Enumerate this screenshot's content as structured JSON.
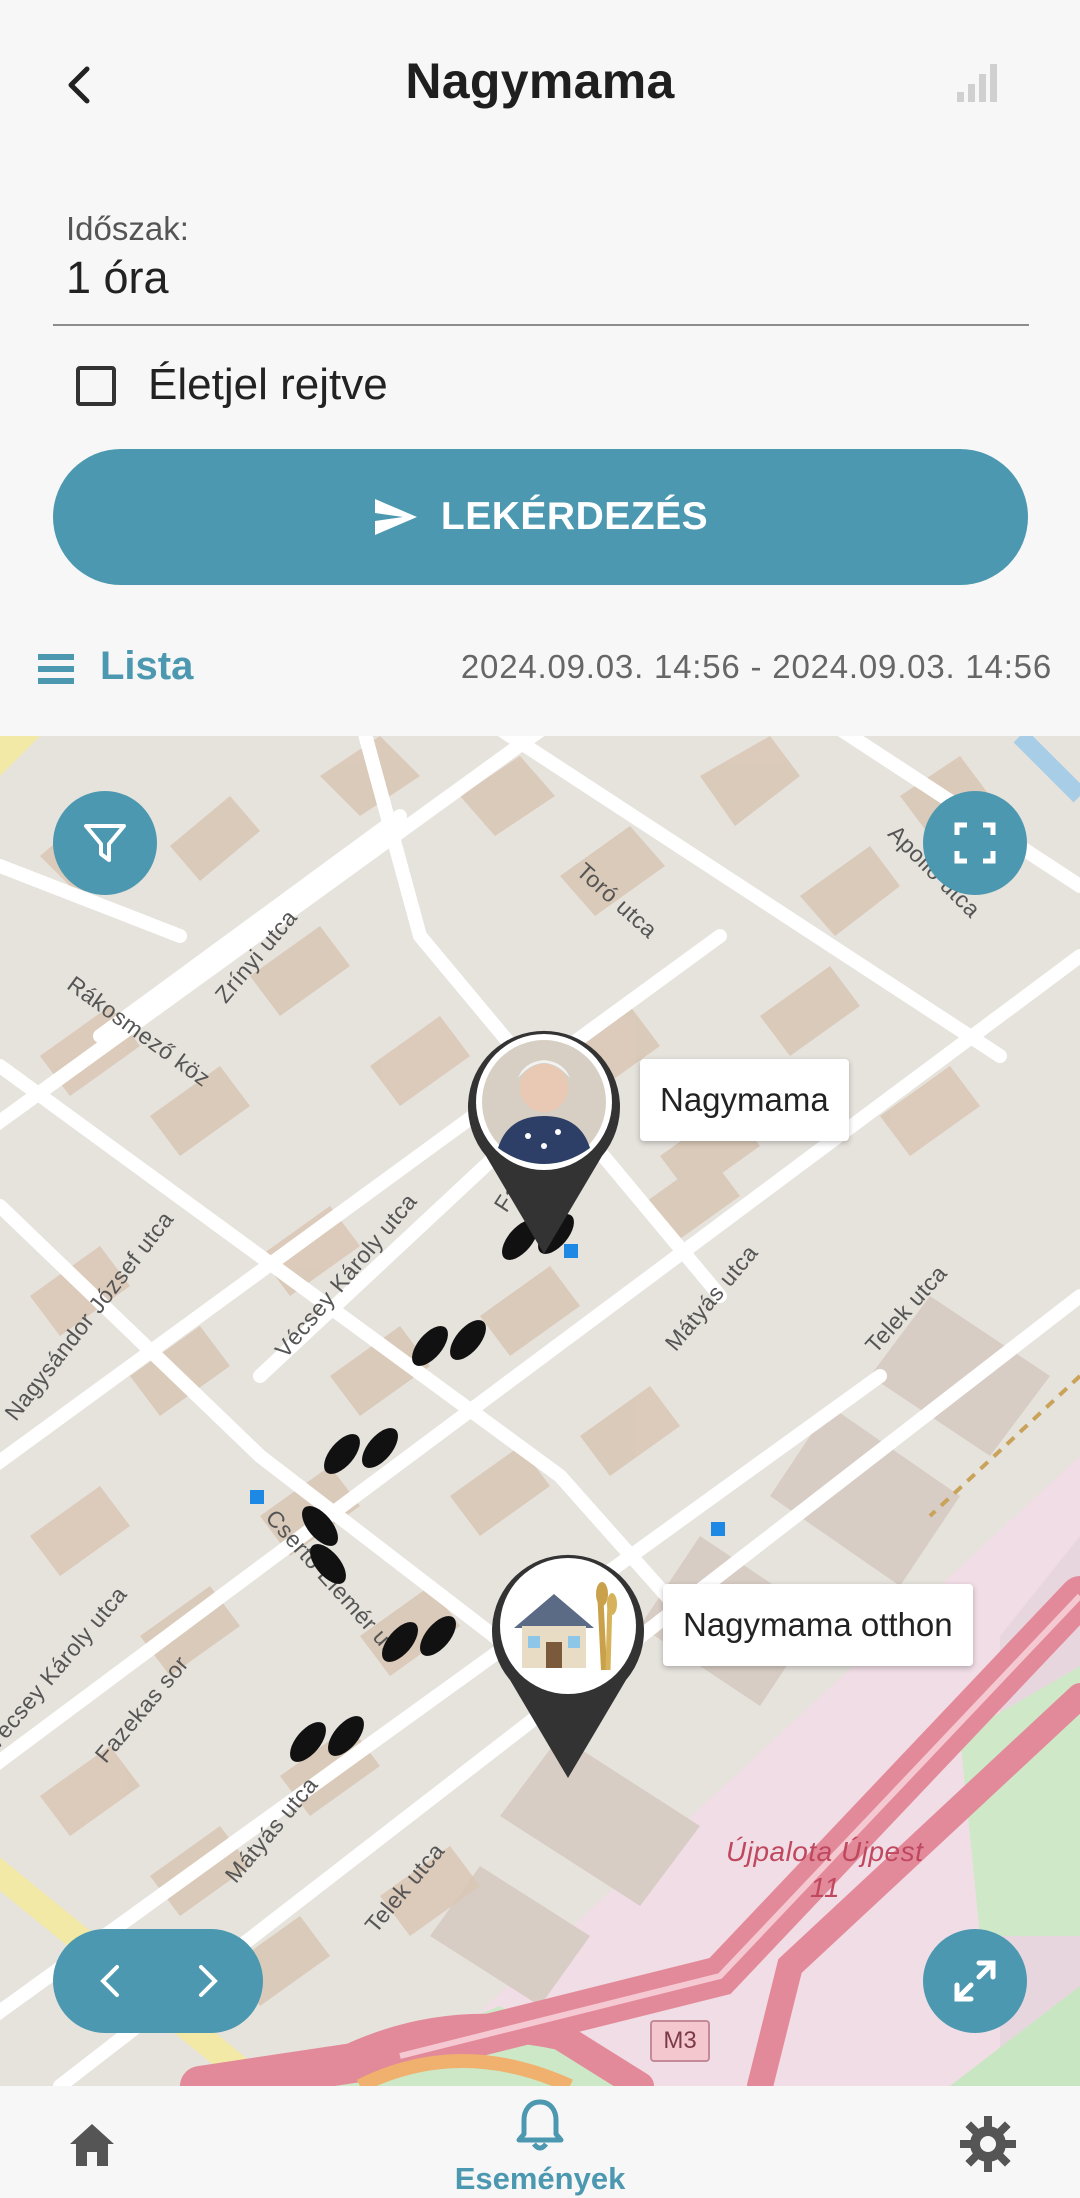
{
  "header": {
    "title": "Nagymama",
    "back_icon": "chevron-left-icon",
    "signal_icon": "signal-bars-icon"
  },
  "period": {
    "label": "Időszak:",
    "value": "1 óra"
  },
  "heartbeat": {
    "label": "Életjel rejtve",
    "checked": false
  },
  "query_button": {
    "label": "LEKÉRDEZÉS",
    "icon": "send-icon"
  },
  "list": {
    "label": "Lista",
    "icon": "list-icon",
    "date_range": "2024.09.03. 14:56 - 2024.09.03. 14:56"
  },
  "map": {
    "markers": [
      {
        "label": "Nagymama",
        "icon": "person-photo-pin"
      },
      {
        "label": "Nagymama otthon",
        "icon": "house-pin"
      }
    ],
    "streets": [
      "Toró utca",
      "Apolló utca",
      "Zrínyi utca",
      "Rákosmező köz",
      "Vécsey Károly utca",
      "Nagysándor József utca",
      "Csertő Elemér u.",
      "Fazekas sor",
      "Mátyás utca",
      "Telek utca",
      "Vécsey Károly utca",
      "Fazekas sor",
      "Mátyás utca",
      "Telek utca"
    ],
    "place_label": "Újpalota Újpest",
    "place_number": "11",
    "road_label": "M3",
    "buttons": {
      "filter": "filter-icon",
      "fullscreen": "fullscreen-icon",
      "expand": "expand-icon",
      "prev": "chevron-left-icon",
      "next": "chevron-right-icon"
    }
  },
  "bottom_nav": {
    "home_icon": "home-icon",
    "events_label": "Események",
    "events_icon": "bell-icon",
    "settings_icon": "gear-icon"
  },
  "colors": {
    "accent": "#4b98b0",
    "road_pink": "#e38a9a",
    "map_bg": "#e6e2dc",
    "building": "#d6c8ba"
  }
}
